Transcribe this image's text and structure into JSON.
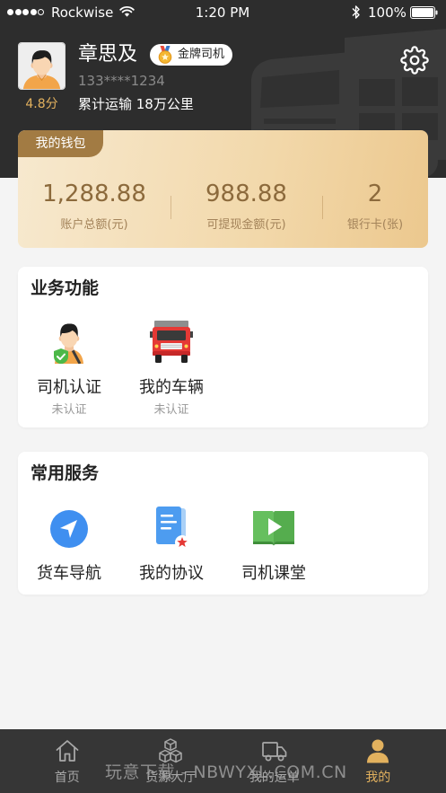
{
  "theme": {
    "header_bg": "#2d2d2d",
    "page_bg": "#f4f4f4",
    "accent_gold": "#e2b15e",
    "wallet_text": "#8c6a3c"
  },
  "status_bar": {
    "signal_filled": 4,
    "signal_total": 5,
    "carrier": "Rockwise",
    "time": "1:20 PM",
    "battery_pct": "100%"
  },
  "profile": {
    "avatar_icon": "driver-avatar-icon",
    "name": "章思及",
    "badge": "金牌司机",
    "badge_icon": "gold-medal-icon",
    "phone": "133****1234",
    "rating": "4.8分",
    "mileage": "累计运输 18万公里",
    "settings_icon": "gear-icon"
  },
  "wallet": {
    "title": "我的钱包",
    "stats": [
      {
        "value": "1,288.88",
        "label": "账户总额(元)"
      },
      {
        "value": "988.88",
        "label": "可提现金额(元)"
      },
      {
        "value": "2",
        "label": "银行卡(张)"
      }
    ]
  },
  "business": {
    "title": "业务功能",
    "items": [
      {
        "icon": "driver-certification-icon",
        "label": "司机认证",
        "status": "未认证"
      },
      {
        "icon": "red-truck-icon",
        "label": "我的车辆",
        "status": "未认证"
      }
    ]
  },
  "services": {
    "title": "常用服务",
    "items": [
      {
        "icon": "navigation-icon",
        "label": "货车导航"
      },
      {
        "icon": "agreement-document-icon",
        "label": "我的协议"
      },
      {
        "icon": "video-book-icon",
        "label": "司机课堂"
      }
    ]
  },
  "tabbar": {
    "active_index": 3,
    "items": [
      {
        "icon": "home-icon",
        "label": "首页"
      },
      {
        "icon": "cargo-boxes-icon",
        "label": "货源大厅"
      },
      {
        "icon": "truck-icon",
        "label": "我的运单"
      },
      {
        "icon": "person-icon",
        "label": "我的"
      }
    ]
  },
  "watermark": "玩意下载 - NBWYXL.COM.CN"
}
